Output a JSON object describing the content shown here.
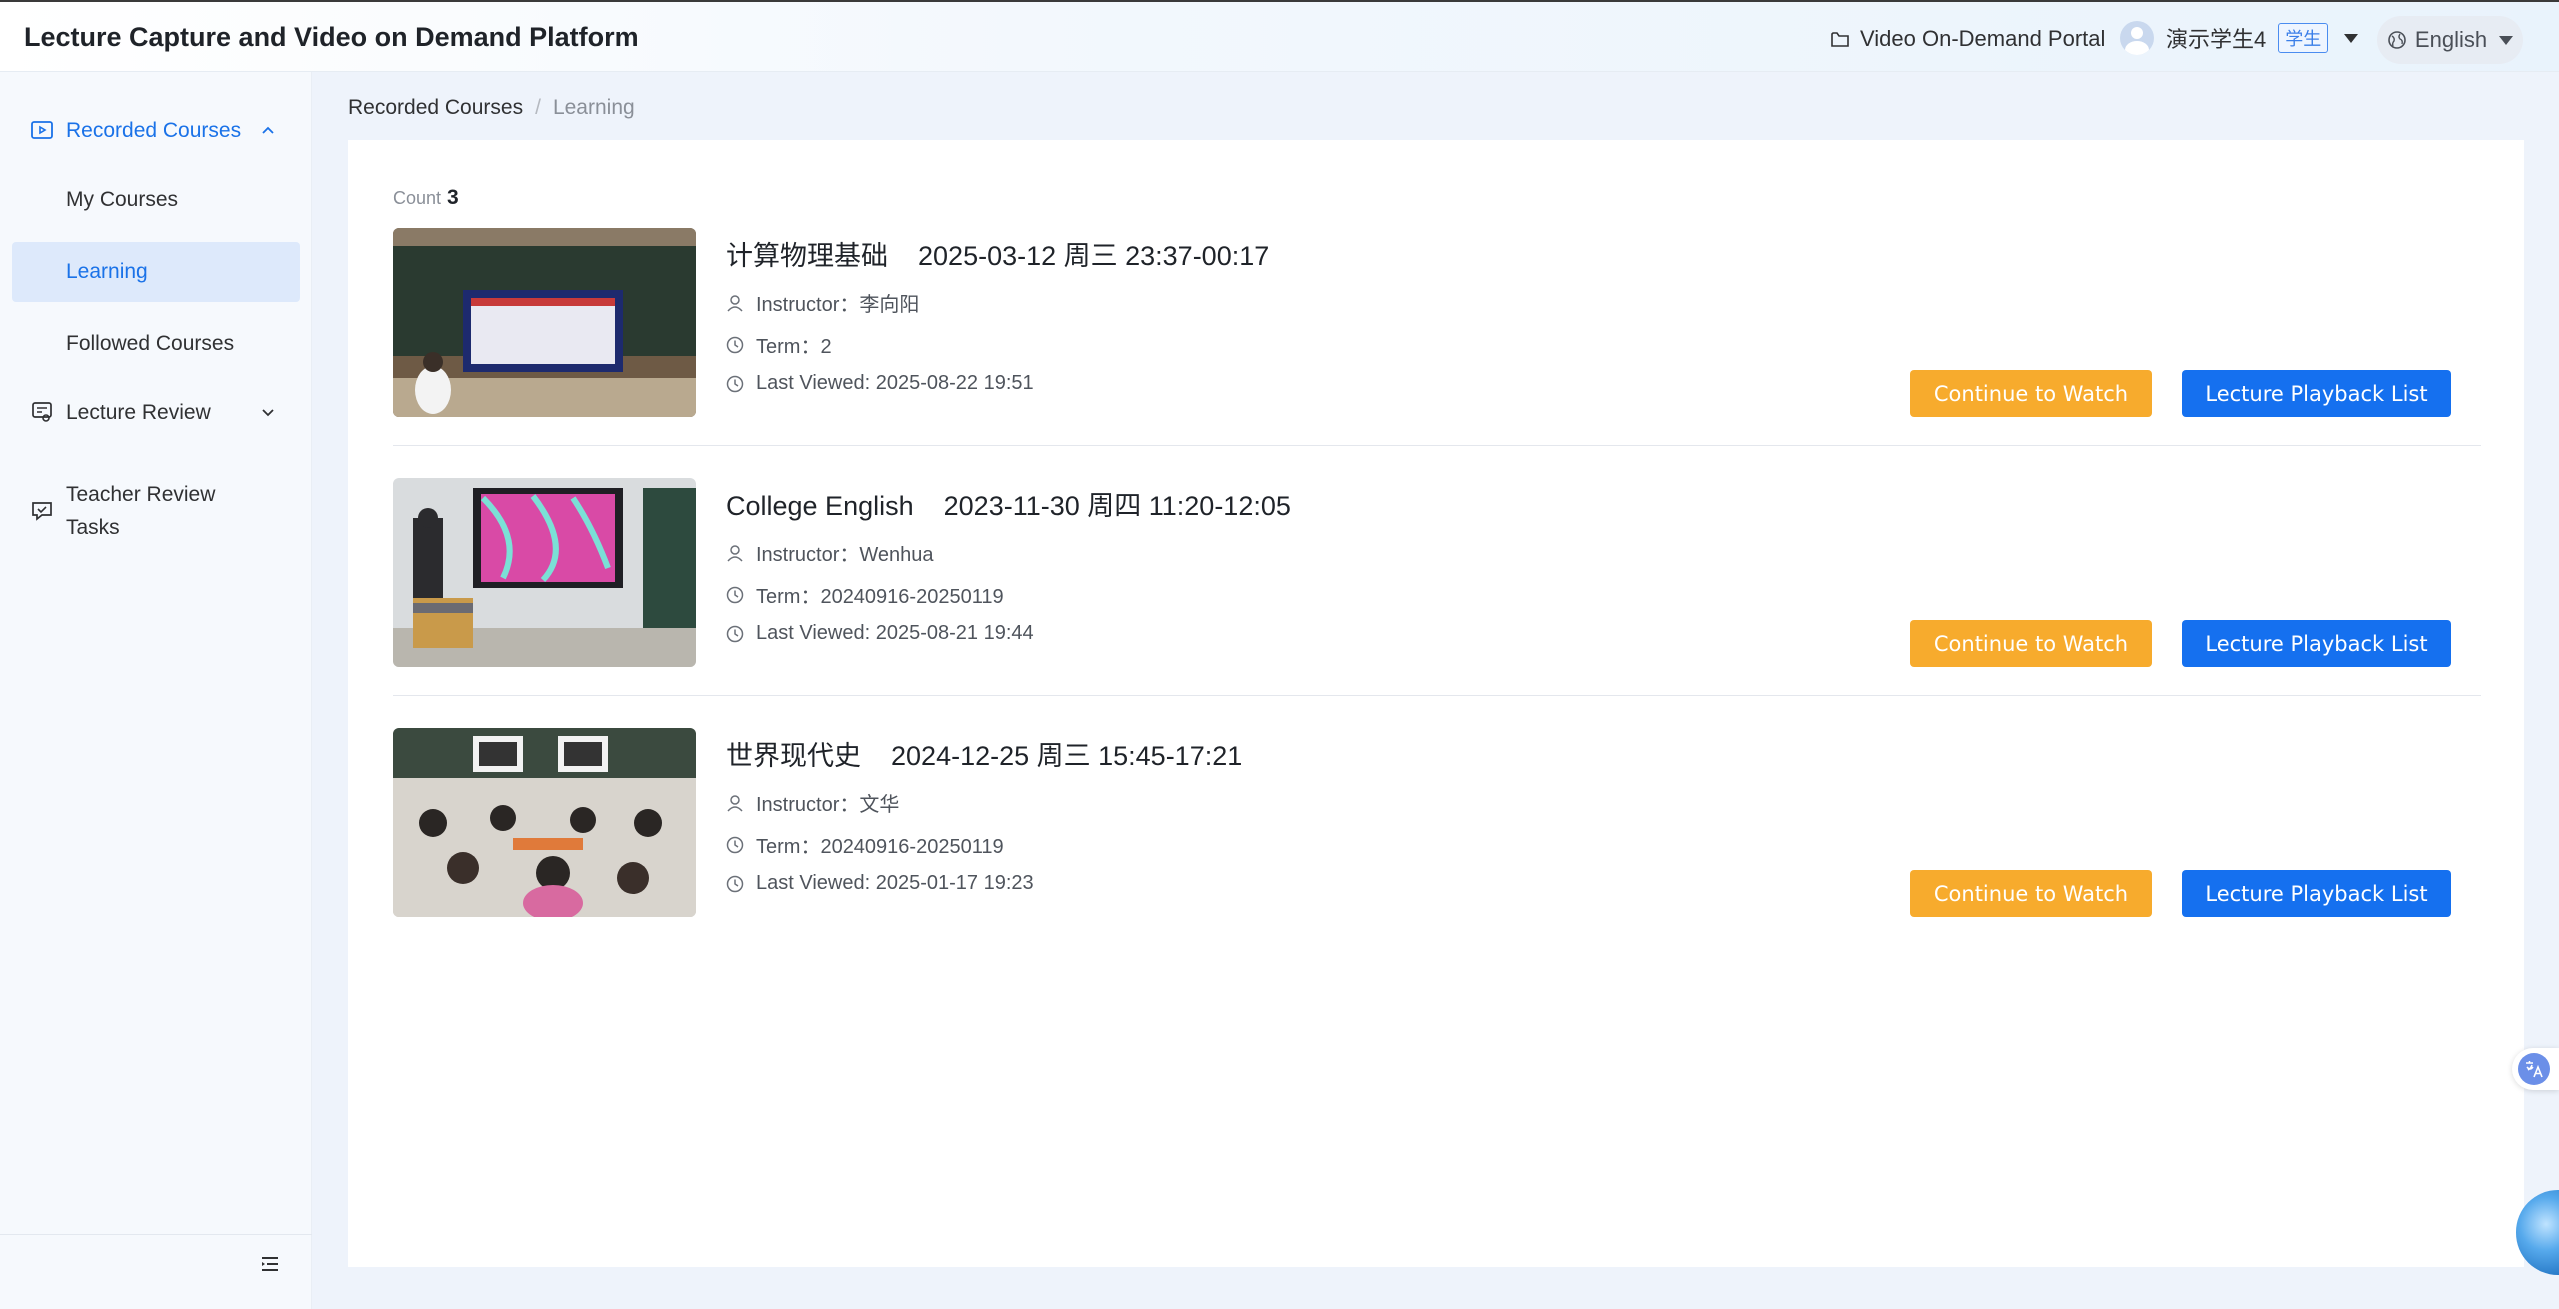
{
  "header": {
    "app_title": "Lecture Capture and Video on Demand Platform",
    "portal_label": "Video On-Demand Portal",
    "user_name": "演示学生4",
    "user_role": "学生",
    "language": "English"
  },
  "sidebar": {
    "groups": [
      {
        "label": "Recorded Courses",
        "icon": "video-icon",
        "expanded": true,
        "active": true
      },
      {
        "label": "Lecture Review",
        "icon": "review-icon",
        "expanded": false
      },
      {
        "label": "Teacher Review\nTasks",
        "icon": "task-chat-icon"
      }
    ],
    "sub_items": [
      {
        "label": "My Courses"
      },
      {
        "label": "Learning",
        "active": true
      },
      {
        "label": "Followed Courses"
      }
    ]
  },
  "breadcrumb": {
    "root": "Recorded Courses",
    "separator": "/",
    "current": "Learning"
  },
  "list": {
    "count_label": "Count",
    "count_value": "3",
    "watch_label": "Continue to Watch",
    "playback_label": "Lecture Playback List",
    "courses": [
      {
        "name": "计算物理基础",
        "datetime": "2025-03-12 周三 23:37-00:17",
        "instructor": "Instructor：李向阳",
        "term": "Term：2",
        "last_viewed": "Last Viewed: 2025-08-22 19:51"
      },
      {
        "name": "College English",
        "datetime": "2023-11-30 周四 11:20-12:05",
        "instructor": "Instructor：Wenhua",
        "term": "Term：20240916-20250119",
        "last_viewed": "Last Viewed: 2025-08-21 19:44"
      },
      {
        "name": "世界现代史",
        "datetime": "2024-12-25 周三 15:45-17:21",
        "instructor": "Instructor：文华",
        "term": "Term：20240916-20250119",
        "last_viewed": "Last Viewed: 2025-01-17 19:23"
      }
    ]
  },
  "colors": {
    "primary": "#1570ef",
    "accent": "#f7ab2d",
    "active_nav_bg": "#dde9fb"
  }
}
